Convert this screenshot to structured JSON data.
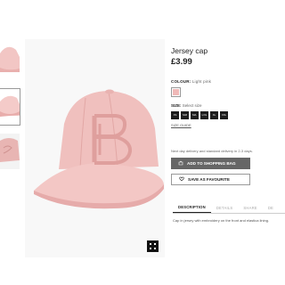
{
  "product": {
    "title": "Jersey cap",
    "price": "£3.99"
  },
  "colour": {
    "label": "COLOUR:",
    "value": "Light pink",
    "swatch_color": "#f0b9b8"
  },
  "size": {
    "label": "SIZE:",
    "value": "Select size",
    "options": [
      "XS",
      "S/M",
      "M/L",
      "L/XL",
      "XL",
      "XXL"
    ],
    "guide_link": "SIZE GUIDE"
  },
  "delivery": {
    "text": "Next day delivery and standard delivery in 2-3 days."
  },
  "actions": {
    "add_to_bag": "ADD TO SHOPPING BAG",
    "save_favourite": "SAVE AS FAVOURITE"
  },
  "tabs": [
    "DESCRIPTION",
    "DETAILS",
    "SHARE",
    "DE"
  ],
  "description": {
    "text": "Cap in jersey with embroidery on the front and elastica lining."
  },
  "icons": {
    "bag": "shopping-bag-icon",
    "heart": "heart-icon",
    "zoom": "zoom-icon"
  }
}
